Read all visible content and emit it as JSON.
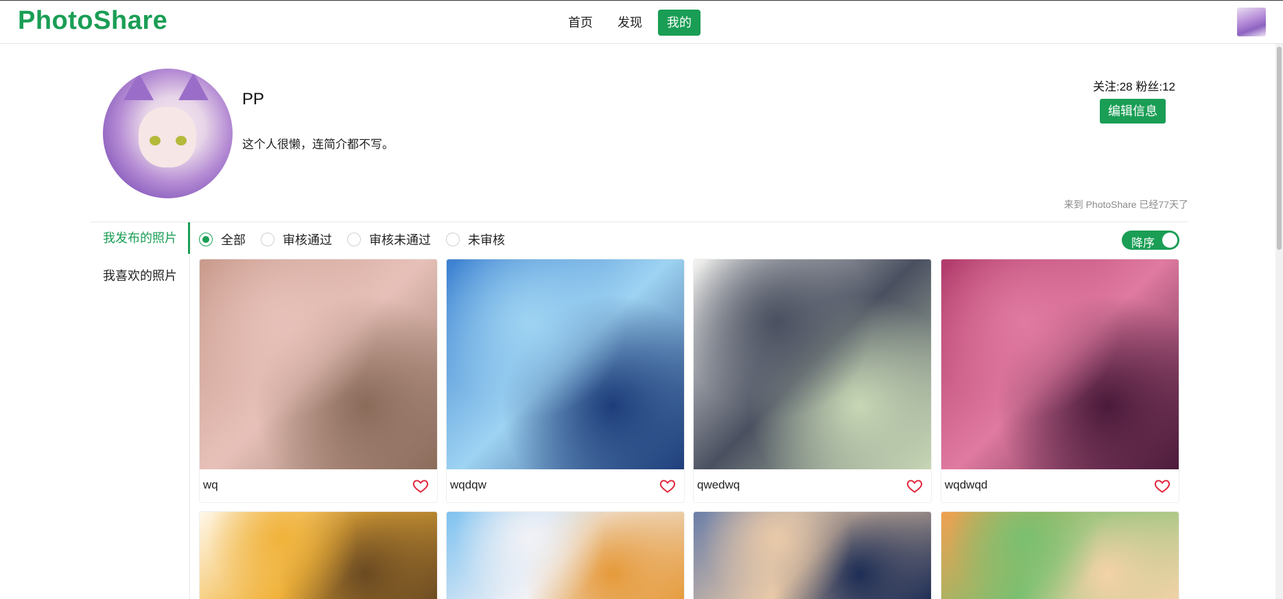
{
  "header": {
    "logo": "PhotoShare",
    "nav": [
      {
        "label": "首页",
        "active": false
      },
      {
        "label": "发现",
        "active": false
      },
      {
        "label": "我的",
        "active": true
      }
    ]
  },
  "profile": {
    "username": "PP",
    "bio": "这个人很懒，连简介都不写。",
    "stats": "关注:28 粉丝:12",
    "edit_label": "编辑信息",
    "days_text": "来到 PhotoShare 已经77天了"
  },
  "side_menu": [
    {
      "label": "我发布的照片",
      "active": true
    },
    {
      "label": "我喜欢的照片",
      "active": false
    }
  ],
  "filters": {
    "options": [
      {
        "label": "全部",
        "checked": true
      },
      {
        "label": "审核通过",
        "checked": false
      },
      {
        "label": "审核未通过",
        "checked": false
      },
      {
        "label": "未审核",
        "checked": false
      }
    ],
    "sort_label": "降序",
    "sort_on": true
  },
  "photos": [
    {
      "title": "wq",
      "palette": [
        "#c89a8c",
        "#e7c1b9",
        "#8a6b5a"
      ]
    },
    {
      "title": "wqdqw",
      "palette": [
        "#3a7fd0",
        "#9ed3f2",
        "#1d3d7a"
      ]
    },
    {
      "title": "qwedwq",
      "palette": [
        "#f3f3f0",
        "#4a5060",
        "#c8d7b5"
      ]
    },
    {
      "title": "wqdwqd",
      "palette": [
        "#b03a6a",
        "#e07aa0",
        "#4a1a3a"
      ]
    },
    {
      "title": "",
      "palette": [
        "#fff7e8",
        "#f0b23a",
        "#6b4a22"
      ]
    },
    {
      "title": "",
      "palette": [
        "#7ec2f0",
        "#f2f2f6",
        "#e69a3a"
      ]
    },
    {
      "title": "",
      "palette": [
        "#6a7ea8",
        "#e9c9a8",
        "#1d2d55"
      ]
    },
    {
      "title": "",
      "palette": [
        "#f0a050",
        "#7ac070",
        "#f4d2a8"
      ]
    }
  ],
  "colors": {
    "accent": "#1a9e55",
    "heart": "#e0243a"
  }
}
